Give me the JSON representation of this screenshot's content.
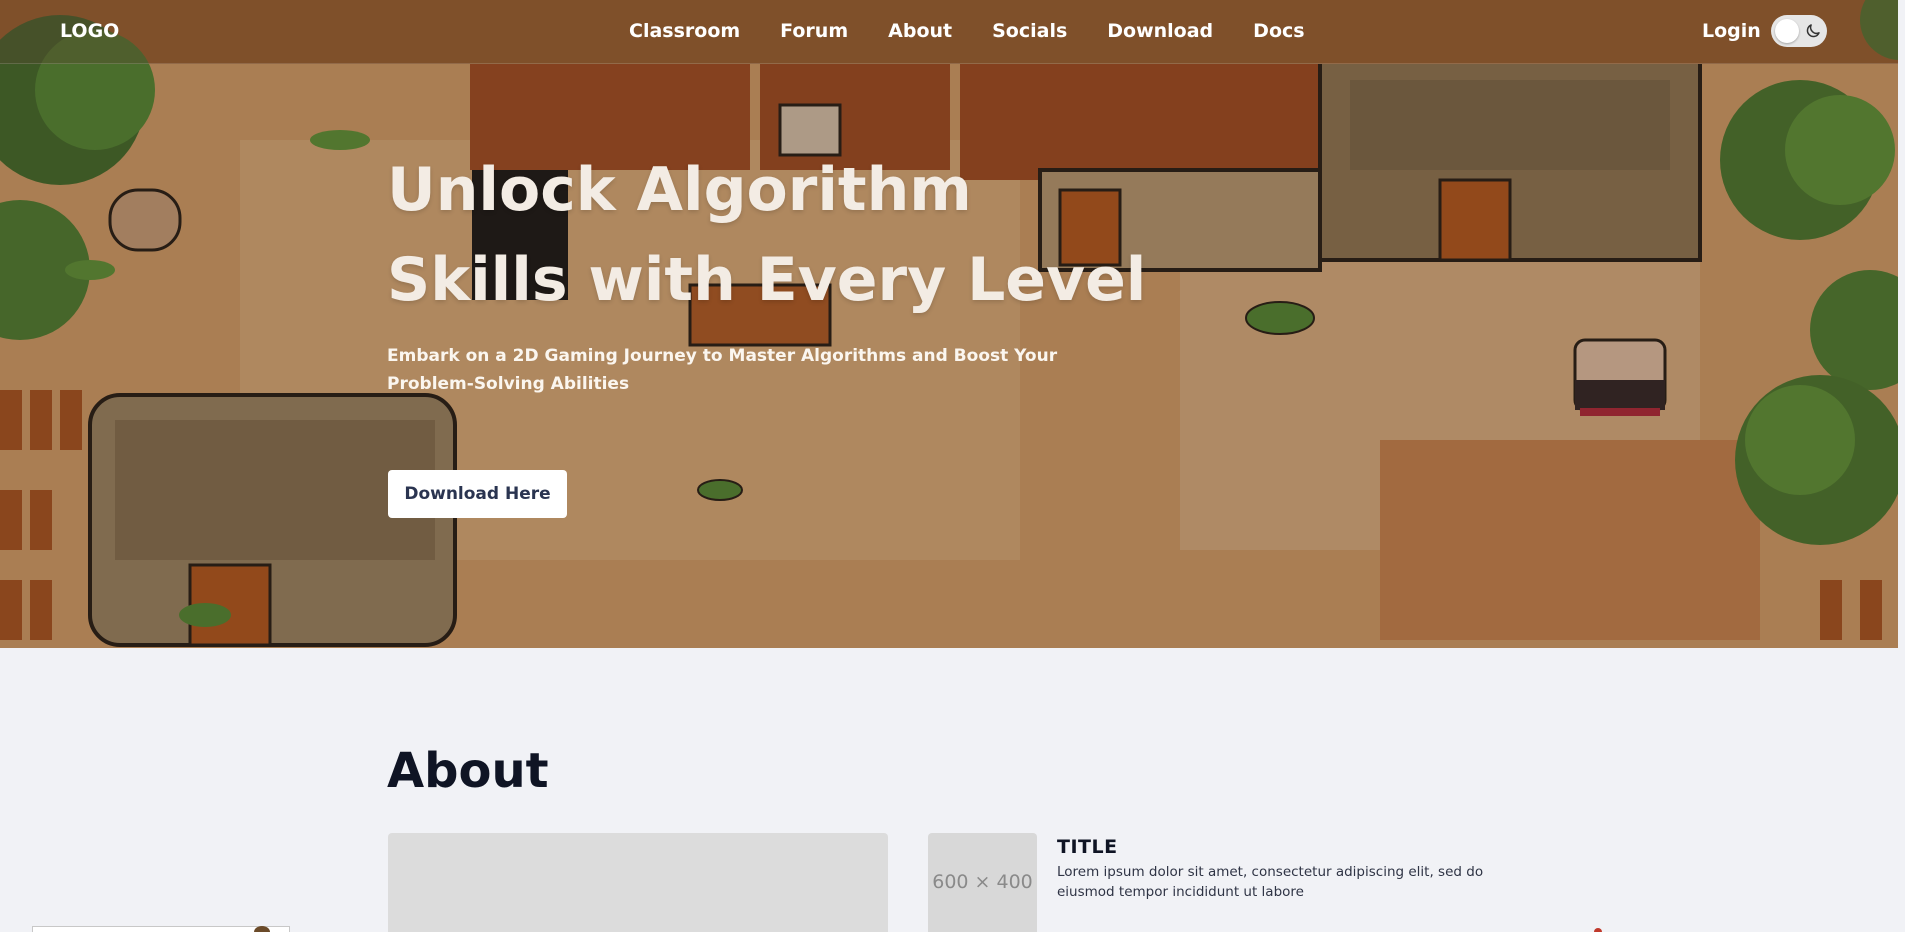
{
  "nav": {
    "logo": "LOGO",
    "links": [
      "Classroom",
      "Forum",
      "About",
      "Socials",
      "Download",
      "Docs"
    ],
    "login": "Login"
  },
  "hero": {
    "title": "Unlock Algorithm Skills with Every Level",
    "subtitle": "Embark on a 2D Gaming Journey to Master Algorithms and Boost Your Problem-Solving Abilities",
    "button": "Download Here"
  },
  "about": {
    "heading": "About",
    "placeholder": "600 × 400",
    "card": {
      "title": "TITLE",
      "text": "Lorem ipsum dolor sit amet, consectetur adipiscing elit, sed do eiusmod tempor incididunt ut labore"
    }
  },
  "colors": {
    "page_bg": "#f1f2f6",
    "button_text": "#2a3450",
    "heading": "#0f1424"
  },
  "icons": {
    "theme": "moon-icon"
  }
}
